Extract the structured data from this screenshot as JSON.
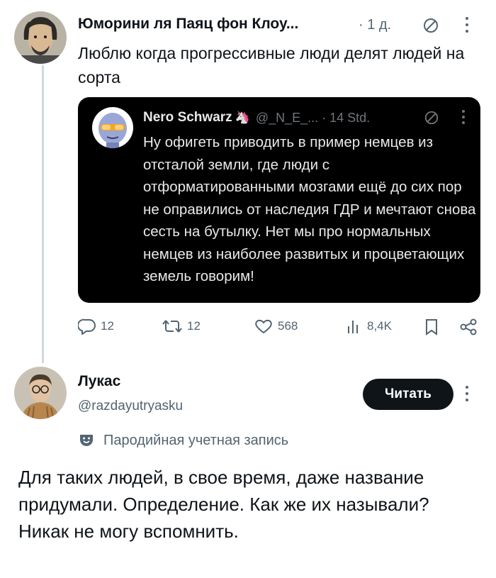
{
  "tweet": {
    "author_name": "Юморини ля Паяц фон Клоу...",
    "time": "· 1 д.",
    "text": "Люблю когда прогрессивные люди делят людей на сорта",
    "quote": {
      "author_name": "Nero Schwarz",
      "emoji": "🦄",
      "handle": "@_N_E_... · 14 Std.",
      "text": "Ну офигеть приводить в пример немцев из отсталой земли, где люди с отформатированными мозгами ещё до сих пор не оправились от наследия ГДР и мечтают снова сесть на бутылку. Нет мы про нормальных немцев из наиболее развитых и процветающих земель говорим!"
    },
    "actions": {
      "replies": "12",
      "retweets": "12",
      "likes": "568",
      "views": "8,4K"
    }
  },
  "reply": {
    "author_name": "Лукас",
    "handle": "@razdayutryasku",
    "follow_label": "Читать",
    "parody_label": "Пародийная учетная запись",
    "text": "Для таких людей, в свое время, даже название придумали. Определение. Как же их называли? Никак не могу вспомнить."
  },
  "colors": {
    "text": "#0f1419",
    "secondary": "#536471",
    "quote_bg": "#000000",
    "thread_line": "#cfd9de"
  }
}
